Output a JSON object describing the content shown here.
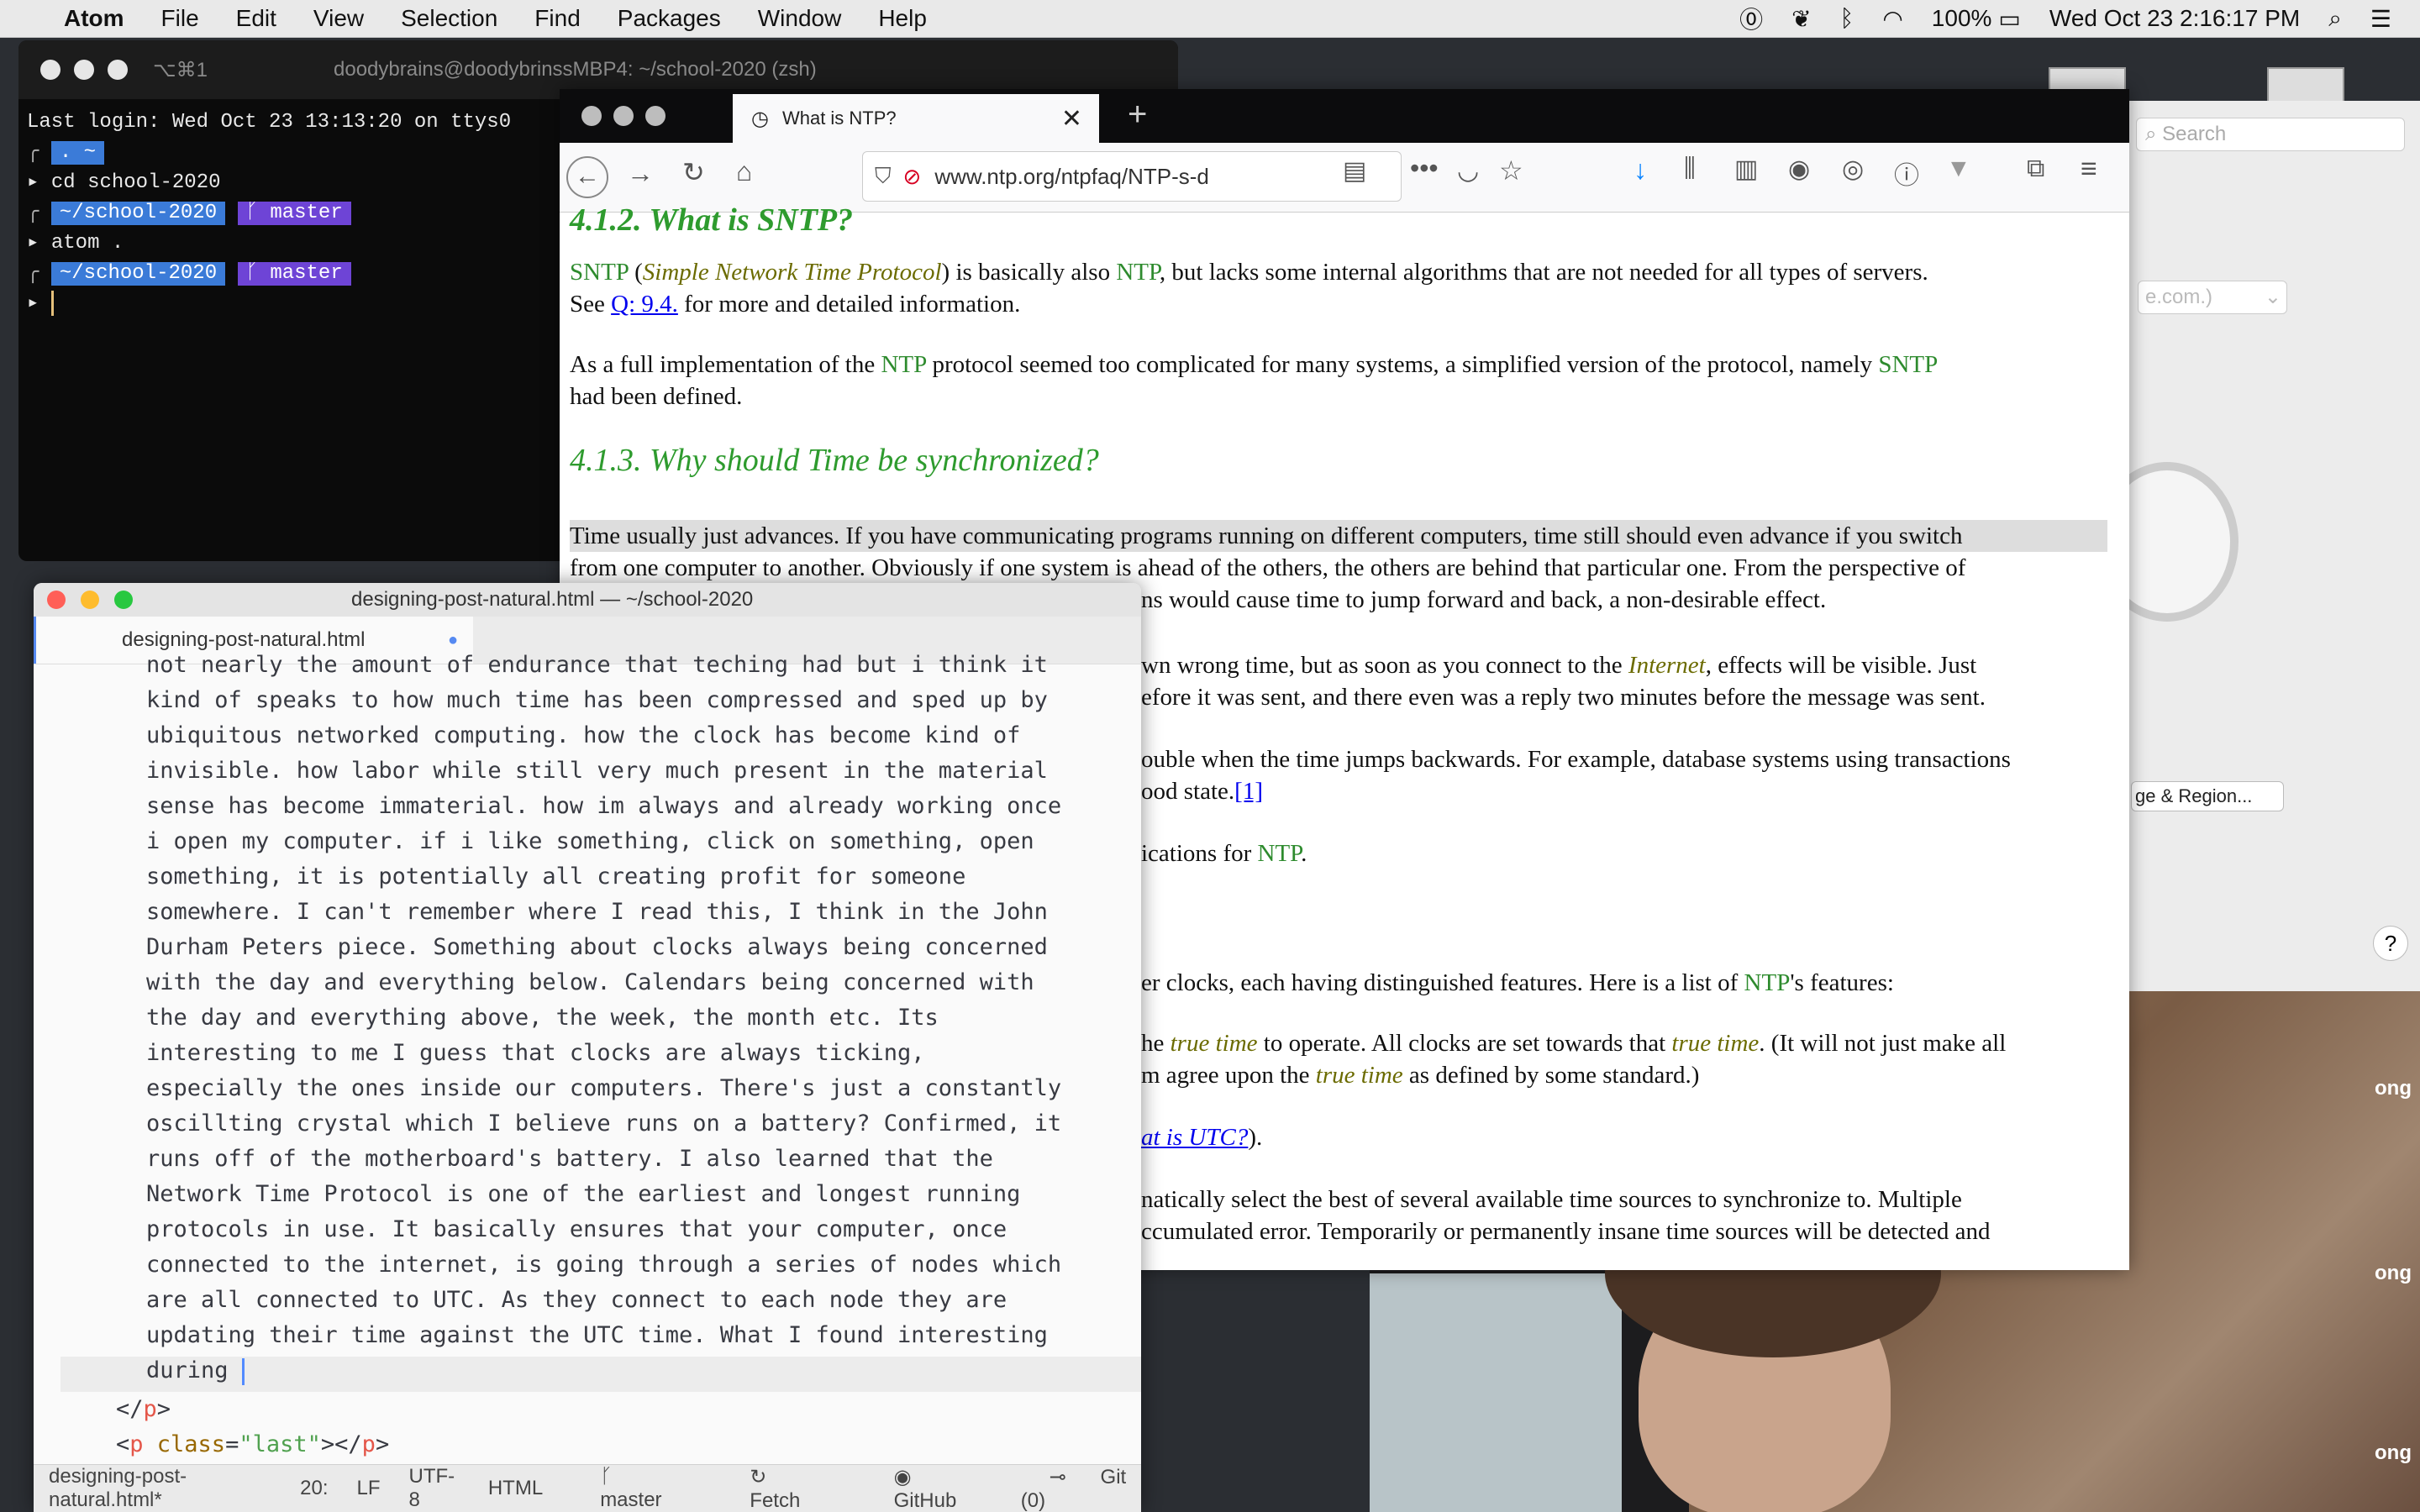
{
  "menubar": {
    "app": "Atom",
    "items": [
      "File",
      "Edit",
      "View",
      "Selection",
      "Find",
      "Packages",
      "Window",
      "Help"
    ],
    "battery": "100%",
    "datetime": "Wed Oct 23  2:16:17 PM"
  },
  "terminal": {
    "shortcut": "⌥⌘1",
    "title": "doodybrains@doodybrinssMBP4: ~/school-2020 (zsh)",
    "last_login": "Last login: Wed Oct 23 13:13:20 on ttys0",
    "prompt1_dir": "~",
    "cmd1": "cd school-2020",
    "dir": "~/school-2020",
    "branch": "master",
    "cmd2": "atom ."
  },
  "firefox": {
    "tab_title": "What is NTP?",
    "url": "www.ntp.org/ntpfaq/NTP-s-d",
    "search_placeholder": "Search",
    "content": {
      "h412": "4.1.2. What is SNTP?",
      "p1_a": "SNTP",
      "p1_b": " (",
      "p1_c": "Simple Network Time Protocol",
      "p1_d": ") is basically also ",
      "p1_e": "NTP",
      "p1_f": ", but lacks some internal algorithms that are not needed for all types of servers.",
      "p1_g": "See ",
      "p1_link": "Q: 9.4.",
      "p1_h": " for more and detailed information.",
      "p2_a": "As a full implementation of the ",
      "p2_b": "NTP",
      "p2_c": " protocol seemed too complicated for many systems, a simplified version of the protocol, namely ",
      "p2_d": "SNTP",
      "p2_e": "had been defined.",
      "h413": "4.1.3. Why should Time be synchronized?",
      "p3_line1": "Time usually just advances. If you have communicating programs running on different computers, time still should even advance if you switch",
      "p3_line2": "from one computer to another. Obviously if one system is ahead of the others, the others are behind that particular one. From the perspective of",
      "p3_line3": "ns would cause time to jump forward and back, a non-desirable effect.",
      "p4_line1a": "wn wrong time, but as soon as you connect to the ",
      "p4_internet": "Internet",
      "p4_line1b": ", effects will be visible. Just",
      "p4_line2": "efore it was sent, and there even was a reply two minutes before the message was sent.",
      "p5_line1": "ouble when the time jumps backwards. For example, database systems using transactions",
      "p5_line2a": "ood state.",
      "p5_ref": "[1]",
      "p6_a": "ications for ",
      "p6_b": "NTP",
      "p6_c": ".",
      "p7_a": "er clocks, each having distinguished features. Here is a list of ",
      "p7_b": "NTP",
      "p7_c": "'s features:",
      "p8_a": "he ",
      "p8_tt1": "true time",
      "p8_b": " to operate. All clocks are set towards that ",
      "p8_tt2": "true time",
      "p8_c": ". (It will not just make all",
      "p8_line2a": "m agree upon the ",
      "p8_tt3": "true time",
      "p8_line2b": " as defined by some standard.)",
      "p9_link": "at is UTC?",
      "p9_b": ").",
      "p10_line1": "natically select the best of several available time sources to synchronize to. Multiple",
      "p10_line2": "ccumulated error. Temporarily or permanently insane time sources will be detected and"
    }
  },
  "prefs": {
    "select_value": "e.com.)",
    "button": "ge & Region...",
    "help": "?"
  },
  "video": {
    "labels": [
      "ong",
      "ong",
      "ong"
    ]
  },
  "atom": {
    "title": "designing-post-natural.html — ~/school-2020",
    "tab": "designing-post-natural.html",
    "lines": [
      "not nearly the amount of endurance that teching had but i think it",
      "kind of speaks to how much time has been compressed and sped up by",
      "ubiquitous networked computing. how the clock has become kind of",
      "invisible. how labor while still very much present in the material",
      "sense has become immaterial. how im always and already working once",
      "i open my computer. if i like something, click on something, open",
      "something, it is potentially all creating profit for someone",
      "somewhere. I can't remember where I read this, I think in the John",
      "Durham Peters piece. Something about clocks always being concerned",
      "with the day and everything below. Calendars being concerned with",
      "the day and everything above, the week, the month etc. Its",
      "interesting to me I guess that clocks are always ticking,",
      "especially the ones inside our computers. There's just a constantly",
      "oscillting crystal which I believe runs on a battery? Confirmed, it",
      "runs off of the motherboard's battery. I also learned that the",
      "Network Time Protocol is one of the earliest and longest running",
      "protocols in use. It basically ensures that your computer, once",
      "connected to the internet, is going through a series of nodes which",
      "are all connected to UTC. As they connect to each node they are",
      "updating their time against the UTC time. What I found interesting",
      "during "
    ],
    "close_p": "</p>",
    "p_last_open": "<p",
    "p_last_attr": " class=",
    "p_last_val": "\"last\"",
    "p_last_close": "></p>",
    "status": {
      "file": "designing-post-natural.html*",
      "pos": "20:",
      "eol": "LF",
      "enc": "UTF-8",
      "grammar": "HTML",
      "branch": "master",
      "fetch": "Fetch",
      "github": "GitHub",
      "git": "Git (0)"
    }
  }
}
